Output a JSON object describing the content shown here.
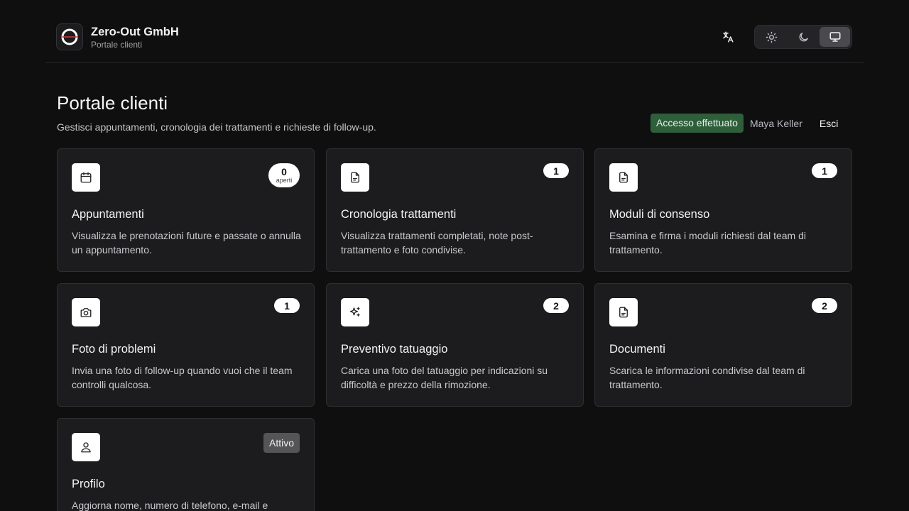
{
  "header": {
    "company": "Zero-Out GmbH",
    "portal_label": "Portale clienti",
    "icons": {
      "logo": "ring-logo-icon",
      "language": "translate-icon",
      "light": "sun-icon",
      "dark": "moon-icon",
      "system": "monitor-icon"
    },
    "theme_active": "system"
  },
  "page": {
    "title": "Portale clienti",
    "subtitle": "Gestisci appuntamenti, cronologia dei trattamenti e richieste di follow-up."
  },
  "session": {
    "status": "Accesso effettuato",
    "user": "Maya Keller",
    "logout": "Esci"
  },
  "colors": {
    "signed_in_badge": "#2e5e3a",
    "card_bg": "#1c1c1e",
    "page_bg": "#0f0f10"
  },
  "cards": [
    {
      "title": "Appuntamenti",
      "desc": "Visualizza le prenotazioni future e passate o annulla un appuntamento.",
      "count": "0",
      "count_label": "aperti",
      "icon": "calendar-icon"
    },
    {
      "title": "Cronologia trattamenti",
      "desc": "Visualizza trattamenti completati, note post-trattamento e foto condivise.",
      "count": "1",
      "icon": "document-icon"
    },
    {
      "title": "Moduli di consenso",
      "desc": "Esamina e firma i moduli richiesti dal team di trattamento.",
      "count": "1",
      "icon": "document-icon"
    },
    {
      "title": "Foto di problemi",
      "desc": "Invia una foto di follow-up quando vuoi che il team controlli qualcosa.",
      "count": "1",
      "icon": "camera-icon"
    },
    {
      "title": "Preventivo tatuaggio",
      "desc": "Carica una foto del tatuaggio per indicazioni su difficoltà e prezzo della rimozione.",
      "count": "2",
      "icon": "sparkles-icon"
    },
    {
      "title": "Documenti",
      "desc": "Scarica le informazioni condivise dal team di trattamento.",
      "count": "2",
      "icon": "document-icon"
    },
    {
      "title": "Profilo",
      "desc": "Aggiorna nome, numero di telefono, e-mail e",
      "status": "Attivo",
      "icon": "user-icon"
    }
  ]
}
